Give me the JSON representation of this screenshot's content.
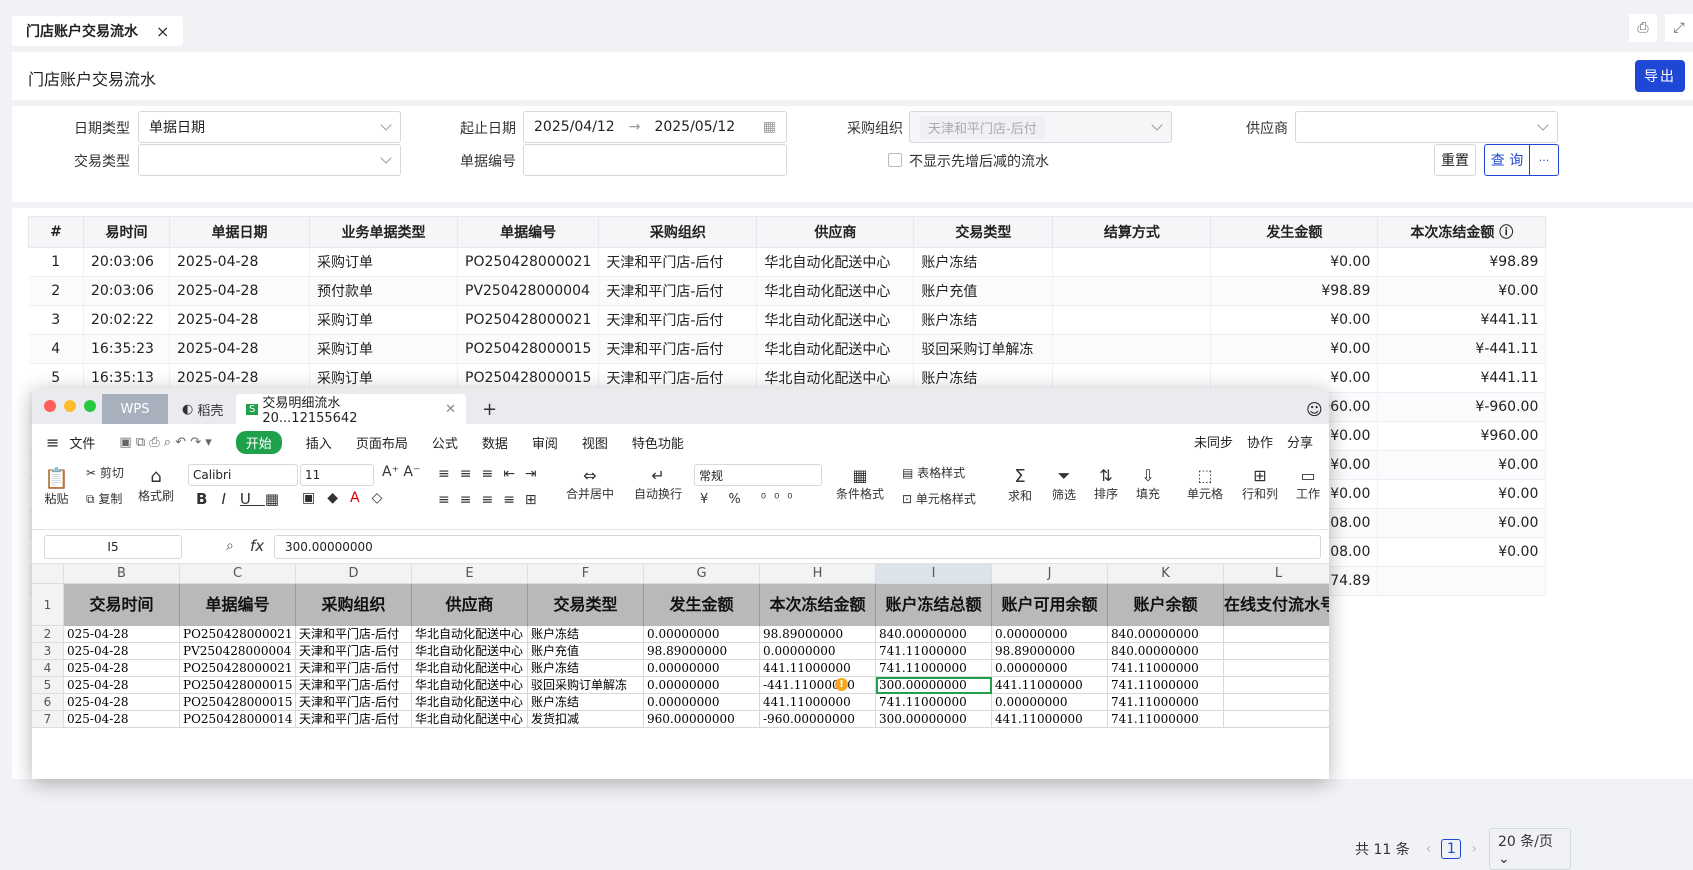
{
  "tabbar": {
    "tab_label": "门店账户交易流水",
    "close": "×"
  },
  "header": {
    "title": "门店账户交易流水",
    "export_label": "导出"
  },
  "filter": {
    "date_type_label": "日期类型",
    "date_type_value": "单据日期",
    "date_range_label": "起止日期",
    "date_start": "2025/04/12",
    "date_end": "2025/05/12",
    "org_label": "采购组织",
    "org_tag": "天津和平门店-后付",
    "supplier_label": "供应商",
    "trade_type_label": "交易类型",
    "doc_no_label": "单据编号",
    "hide_label": "不显示先增后减的流水",
    "reset_label": "重置",
    "query_label": "查 询",
    "more_label": "···"
  },
  "table": {
    "columns": [
      "#",
      "易时间",
      "单据日期",
      "业务单据类型",
      "单据编号",
      "采购组织",
      "供应商",
      "交易类型",
      "结算方式",
      "发生金额",
      "本次冻结金额"
    ],
    "rows": [
      [
        "1",
        "20:03:06",
        "2025-04-28",
        "采购订单",
        "PO250428000021",
        "天津和平门店-后付",
        "华北自动化配送中心",
        "账户冻结",
        "",
        "¥0.00",
        "¥98.89"
      ],
      [
        "2",
        "20:03:06",
        "2025-04-28",
        "预付款单",
        "PV250428000004",
        "天津和平门店-后付",
        "华北自动化配送中心",
        "账户充值",
        "",
        "¥98.89",
        "¥0.00"
      ],
      [
        "3",
        "20:02:22",
        "2025-04-28",
        "采购订单",
        "PO250428000021",
        "天津和平门店-后付",
        "华北自动化配送中心",
        "账户冻结",
        "",
        "¥0.00",
        "¥441.11"
      ],
      [
        "4",
        "16:35:23",
        "2025-04-28",
        "采购订单",
        "PO250428000015",
        "天津和平门店-后付",
        "华北自动化配送中心",
        "驳回采购订单解冻",
        "",
        "¥0.00",
        "¥-441.11"
      ],
      [
        "5",
        "16:35:13",
        "2025-04-28",
        "采购订单",
        "PO250428000015",
        "天津和平门店-后付",
        "华北自动化配送中心",
        "账户冻结",
        "",
        "¥0.00",
        "¥441.11"
      ]
    ],
    "peek_values": [
      [
        "¥960.00",
        "¥-960.00"
      ],
      [
        "¥0.00",
        "¥960.00"
      ],
      [
        "¥0.00",
        "¥0.00"
      ],
      [
        "¥0.00",
        "¥0.00"
      ],
      [
        "108.00",
        "¥0.00"
      ],
      [
        "108.00",
        "¥0.00"
      ],
      [
        "274.89",
        ""
      ]
    ]
  },
  "pager": {
    "total": "共 11 条",
    "page": "1",
    "size": "20 条/页"
  },
  "wps": {
    "tab_wps": "WPS",
    "tab_daoke": "稻壳",
    "tab_file": "交易明细流水20...12155642",
    "menu": [
      "文件",
      "开始",
      "插入",
      "页面布局",
      "公式",
      "数据",
      "审阅",
      "视图",
      "特色功能"
    ],
    "right_menu": [
      "未同步",
      "协作",
      "分享"
    ],
    "ribbon": {
      "paste": "粘贴",
      "cut": "剪切",
      "copy": "复制",
      "format_painter": "格式刷",
      "font": "Calibri",
      "size": "11",
      "number_format": "常规",
      "merge": "合并居中",
      "wrap": "自动换行",
      "cond_format": "条件格式",
      "table_style": "表格样式",
      "cell_style": "单元格样式",
      "sum": "求和",
      "filter": "筛选",
      "sort": "排序",
      "fill": "填充",
      "cell": "单元格",
      "rowcol": "行和列",
      "work": "工作"
    },
    "namebox": "I5",
    "fx": "fx",
    "formula": "300.00000000",
    "col_letters": [
      "B",
      "C",
      "D",
      "E",
      "F",
      "G",
      "H",
      "I",
      "J",
      "K",
      "L"
    ],
    "header_row": [
      "交易时间",
      "单据编号",
      "采购组织",
      "供应商",
      "交易类型",
      "发生金额",
      "本次冻结金额",
      "账户冻结总额",
      "账户可用余额",
      "账户余额",
      "在线支付流水号"
    ],
    "rows": [
      [
        "2",
        "025-04-28",
        "PO250428000021",
        "天津和平门店-后付",
        "华北自动化配送中心",
        "账户冻结",
        "0.00000000",
        "98.89000000",
        "840.00000000",
        "0.00000000",
        "840.00000000",
        ""
      ],
      [
        "3",
        "025-04-28",
        "PV250428000004",
        "天津和平门店-后付",
        "华北自动化配送中心",
        "账户充值",
        "98.89000000",
        "0.00000000",
        "741.11000000",
        "98.89000000",
        "840.00000000",
        ""
      ],
      [
        "4",
        "025-04-28",
        "PO250428000021",
        "天津和平门店-后付",
        "华北自动化配送中心",
        "账户冻结",
        "0.00000000",
        "441.11000000",
        "741.11000000",
        "0.00000000",
        "741.11000000",
        ""
      ],
      [
        "5",
        "025-04-28",
        "PO250428000015",
        "天津和平门店-后付",
        "华北自动化配送中心",
        "驳回采购订单解冻",
        "0.00000000",
        "-441.11000000",
        "300.00000000",
        "441.11000000",
        "741.11000000",
        ""
      ],
      [
        "6",
        "025-04-28",
        "PO250428000015",
        "天津和平门店-后付",
        "华北自动化配送中心",
        "账户冻结",
        "0.00000000",
        "441.11000000",
        "741.11000000",
        "0.00000000",
        "741.11000000",
        ""
      ],
      [
        "7",
        "025-04-28",
        "PO250428000014",
        "天津和平门店-后付",
        "华北自动化配送中心",
        "发货扣减",
        "960.00000000",
        "-960.00000000",
        "300.00000000",
        "441.11000000",
        "741.11000000",
        ""
      ]
    ]
  }
}
